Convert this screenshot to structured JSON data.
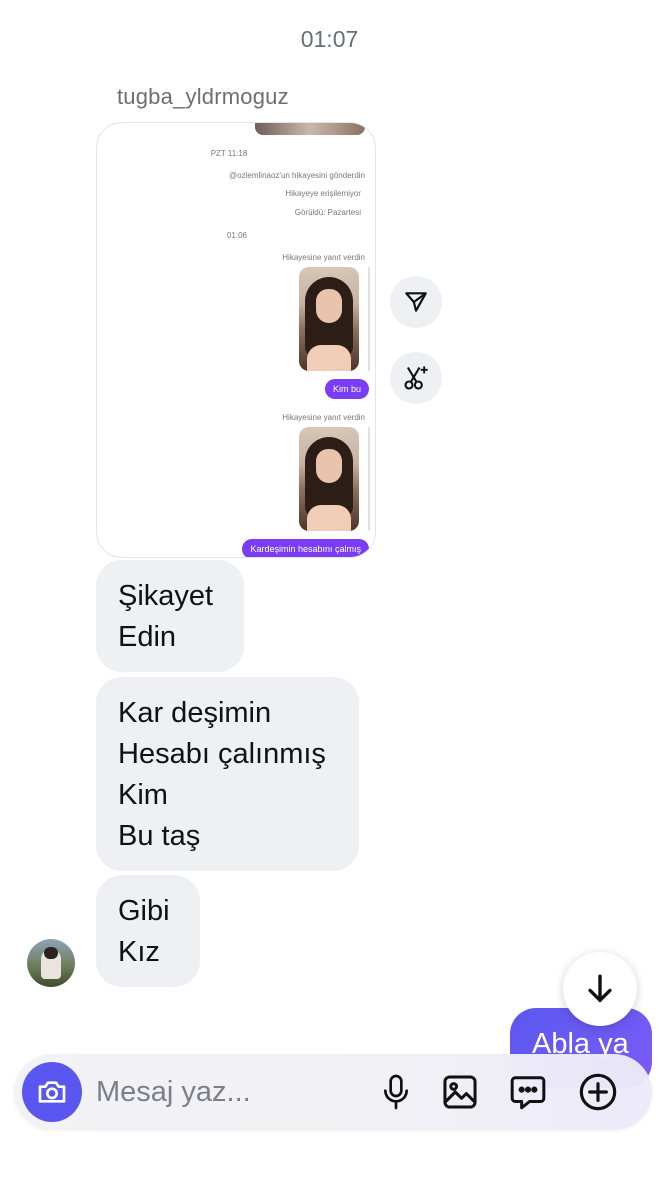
{
  "header": {
    "time": "01:07"
  },
  "thread": {
    "sender_name": "tugba_yldrmoguz",
    "shared_screenshot": {
      "timestamp_1": "PZT 11:18",
      "story_sent": "@ozlemlinaoz'un hikayesini gönderdin",
      "story_unavailable": "Hikayeye erişilemiyor",
      "seen": "Görüldü: Pazartesi",
      "timestamp_2": "01:06",
      "reply_label_1": "Hikayesine yanıt verdin",
      "bubble_1": "Kim bu",
      "reply_label_2": "Hikayesine yanıt verdin",
      "bubble_2": "Kardeşimin hesabını çalmış"
    },
    "received_messages": [
      {
        "lines": [
          "Şikayet",
          "Edin"
        ]
      },
      {
        "lines": [
          "Kar deşimin",
          "Hesabı çalınmış",
          "Kim",
          "Bu taş"
        ]
      },
      {
        "lines": [
          "Gibi",
          "Kız"
        ]
      }
    ],
    "sent_message": "Abla ya"
  },
  "actions": {
    "share_icon": "send-icon",
    "ai_icon": "scissors-sparkle-icon"
  },
  "composer": {
    "placeholder": "Mesaj yaz...",
    "icons": [
      "camera-icon",
      "microphone-icon",
      "gallery-icon",
      "sticker-chat-icon",
      "plus-icon"
    ]
  },
  "colors": {
    "accent": "#5a56f0",
    "bubble_received": "#eff0f3",
    "story_bubble": "#7a3cf5"
  }
}
